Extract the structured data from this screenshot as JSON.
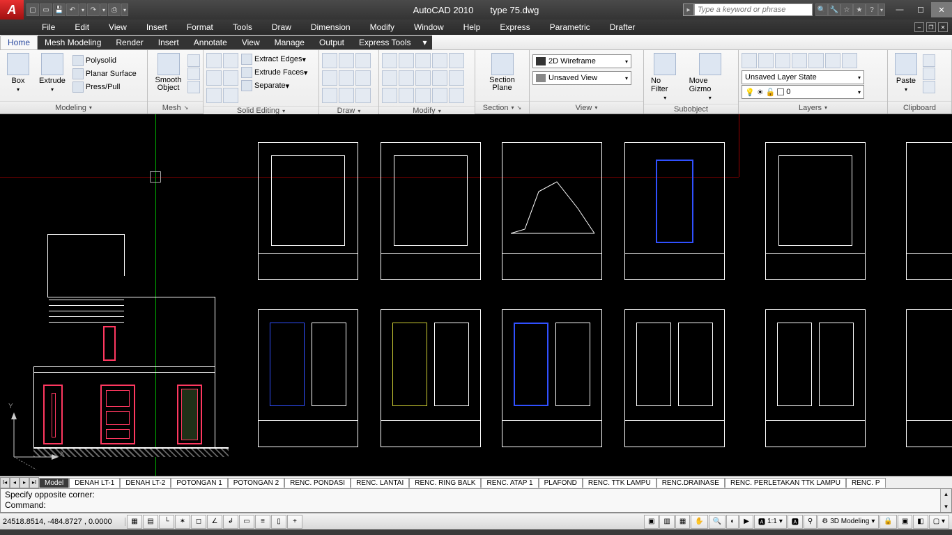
{
  "title": {
    "app": "AutoCAD 2010",
    "file": "type 75.dwg"
  },
  "search": {
    "placeholder": "Type a keyword or phrase"
  },
  "menubar": [
    "File",
    "Edit",
    "View",
    "Insert",
    "Format",
    "Tools",
    "Draw",
    "Dimension",
    "Modify",
    "Window",
    "Help",
    "Express",
    "Parametric",
    "Drafter"
  ],
  "ribbonTabs": [
    "Home",
    "Mesh Modeling",
    "Render",
    "Insert",
    "Annotate",
    "View",
    "Manage",
    "Output",
    "Express Tools"
  ],
  "panels": {
    "modeling": {
      "label": "Modeling",
      "box": "Box",
      "extrude": "Extrude",
      "polysolid": "Polysolid",
      "planar": "Planar Surface",
      "press": "Press/Pull"
    },
    "mesh": {
      "label": "Mesh",
      "smooth": "Smooth Object"
    },
    "solid": {
      "label": "Solid Editing",
      "extract": "Extract Edges",
      "extrudeFaces": "Extrude Faces",
      "separate": "Separate"
    },
    "draw": {
      "label": "Draw"
    },
    "modify": {
      "label": "Modify"
    },
    "section": {
      "label": "Section",
      "plane": "Section Plane"
    },
    "view": {
      "label": "View",
      "style": "2D Wireframe",
      "saved": "Unsaved View"
    },
    "subobject": {
      "label": "Subobject",
      "filter": "No Filter",
      "gizmo": "Move Gizmo"
    },
    "layers": {
      "label": "Layers",
      "state": "Unsaved Layer State",
      "current": "0"
    },
    "clipboard": {
      "label": "Clipboard",
      "paste": "Paste"
    }
  },
  "layoutTabs": [
    "Model",
    "DENAH LT-1",
    "DENAH LT-2",
    "POTONGAN 1",
    "POTONGAN 2",
    "RENC. PONDASI",
    "RENC. LANTAI",
    "RENC. RING BALK",
    "RENC. ATAP 1",
    "PLAFOND",
    "RENC. TTK LAMPU",
    "RENC.DRAINASE",
    "RENC. PERLETAKAN TTK LAMPU",
    "RENC. P"
  ],
  "command": {
    "line1": "Specify opposite corner:",
    "line2": "Command:"
  },
  "status": {
    "coords": "24518.8514, -484.8727 , 0.0000",
    "scale": "1:1",
    "workspace": "3D Modeling"
  },
  "ucs": {
    "x": "X",
    "y": "Y"
  }
}
